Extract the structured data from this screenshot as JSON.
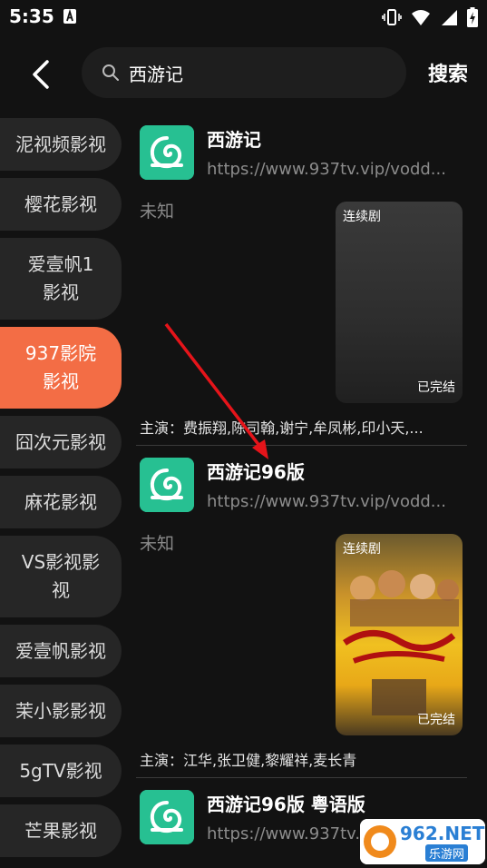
{
  "statusbar": {
    "time": "5:35"
  },
  "search": {
    "query": "西游记",
    "button": "搜索"
  },
  "sidebar": {
    "items": [
      {
        "label": "泥视频影视"
      },
      {
        "label": "樱花影视"
      },
      {
        "label": "爱壹帆1影视"
      },
      {
        "label": "937影院影视"
      },
      {
        "label": "囧次元影视"
      },
      {
        "label": "麻花影视"
      },
      {
        "label": "VS影视影视"
      },
      {
        "label": "爱壹帆影视"
      },
      {
        "label": "茉小影影视"
      },
      {
        "label": "5gTV影视"
      },
      {
        "label": "芒果影视"
      }
    ],
    "active_index": 3
  },
  "results": [
    {
      "title": "西游记",
      "url": "https://www.937tv.vip/vodd...",
      "meta": "未知",
      "tag": "连续剧",
      "status": "已完结",
      "actors": "主演：费振翔,陈司翰,谢宁,牟凤彬,印小天,..."
    },
    {
      "title": "西游记96版",
      "url": "https://www.937tv.vip/vodd...",
      "meta": "未知",
      "tag": "连续剧",
      "status": "已完结",
      "actors": "主演：江华,张卫健,黎耀祥,麦长青"
    },
    {
      "title": "西游记96版 粤语版",
      "url": "https://www.937tv.vip/vodd..."
    }
  ],
  "watermark": {
    "text": "962.NET",
    "sub": "乐游网"
  },
  "colors": {
    "accent": "#f36d45",
    "logo": "#27c092",
    "background": "#121212"
  }
}
